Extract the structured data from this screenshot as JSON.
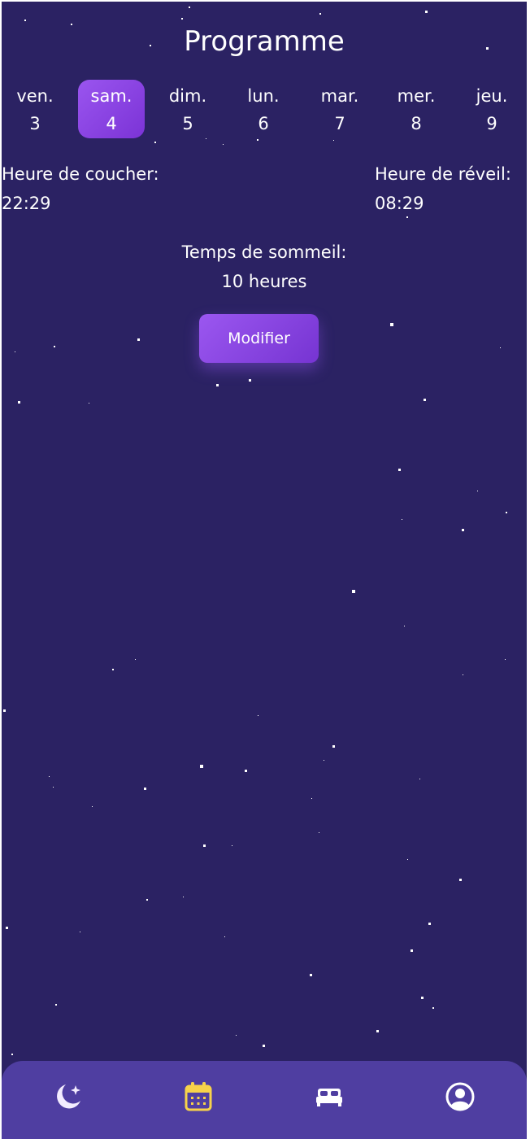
{
  "header": {
    "title": "Programme"
  },
  "days": [
    {
      "name": "ven.",
      "number": "3",
      "selected": false
    },
    {
      "name": "sam.",
      "number": "4",
      "selected": true
    },
    {
      "name": "dim.",
      "number": "5",
      "selected": false
    },
    {
      "name": "lun.",
      "number": "6",
      "selected": false
    },
    {
      "name": "mar.",
      "number": "7",
      "selected": false
    },
    {
      "name": "mer.",
      "number": "8",
      "selected": false
    },
    {
      "name": "jeu.",
      "number": "9",
      "selected": false
    }
  ],
  "schedule": {
    "bedtime_label": "Heure de coucher:",
    "bedtime_value": "22:29",
    "wake_label": "Heure de réveil:",
    "wake_value": "08:29",
    "sleep_label": "Temps de sommeil:",
    "sleep_value": "10 heures",
    "modify_label": "Modifier"
  },
  "bottom_nav": {
    "items": [
      {
        "icon": "moon-stars-icon",
        "active": false
      },
      {
        "icon": "calendar-icon",
        "active": true
      },
      {
        "icon": "bed-icon",
        "active": false
      },
      {
        "icon": "profile-icon",
        "active": false
      }
    ]
  },
  "colors": {
    "background": "#2b2263",
    "accent": "#8b45e6",
    "nav_background": "#4f3ea1",
    "active_nav_icon": "#f7d24a",
    "nav_icon": "#ffffff"
  }
}
